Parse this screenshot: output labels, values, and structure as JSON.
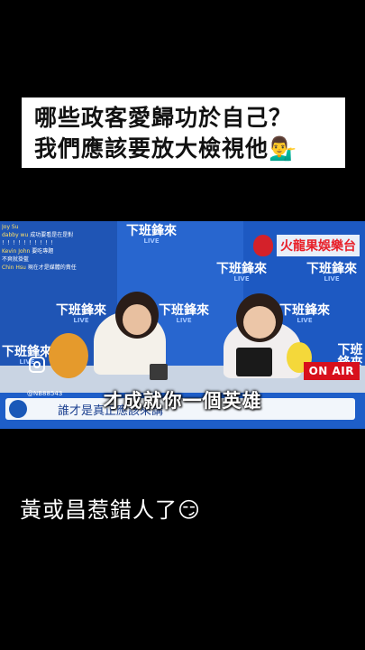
{
  "headline": {
    "line1": "哪些政客愛歸功於自己？",
    "line2": "我們應該要放大檢視他💁‍♂️"
  },
  "video": {
    "brand": "火龍果娛樂台",
    "onair": "ON AIR",
    "handle": "@NB88543",
    "logo_text": "下班鋒來",
    "logo_sub": "LIVE",
    "ticker": "誰才是真正應該來講",
    "subtitle": "才成就你一個英雄",
    "chat": [
      {
        "user": "Joy Su",
        "text": ""
      },
      {
        "user": "dabby wu",
        "text": "成功要看是在是對"
      },
      {
        "user": "",
        "text": "！！！！！！！！！！"
      },
      {
        "user": "Kevin John",
        "text": "要吃專題"
      },
      {
        "user": "",
        "text": "不爽就掛藍"
      },
      {
        "user": "Chin Hsu",
        "text": "現在才是媒體的責任"
      }
    ]
  },
  "caption": "黃或昌惹錯人了😏"
}
